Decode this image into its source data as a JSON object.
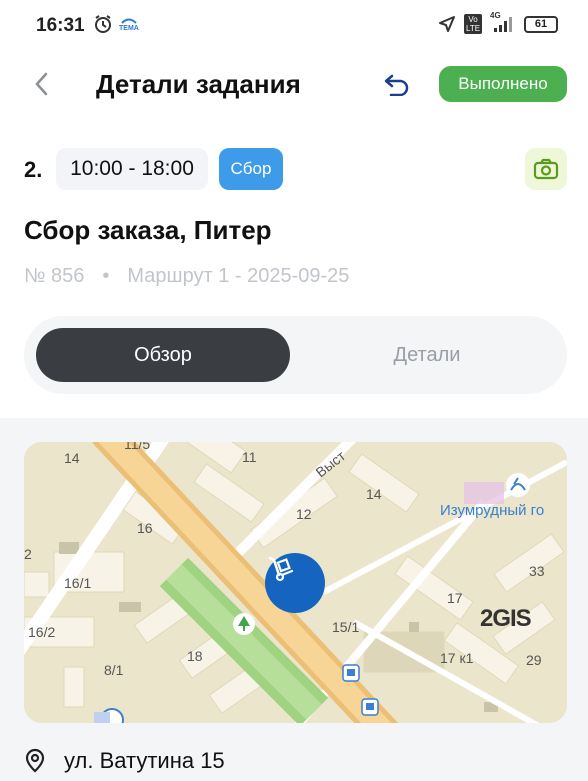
{
  "status_bar": {
    "time": "16:31",
    "battery": "61",
    "network_type": "4G",
    "volte_badge": "Vo LTE",
    "carrier_badge": "TEMA",
    "icons": [
      "alarm-icon",
      "location-arrow-icon",
      "signal-icon"
    ]
  },
  "header": {
    "title": "Детали задания",
    "done_button": "Выполнено",
    "icons": [
      "back-chevron-icon",
      "undo-icon"
    ]
  },
  "task": {
    "index": "2.",
    "time_range": "10:00 - 18:00",
    "type": "Сбор",
    "title": "Сбор заказа, Питер",
    "number": "№ 856",
    "separator": "•",
    "route": "Маршрут 1 - 2025-09-25",
    "camera_icon": "camera-icon"
  },
  "tabs": {
    "overview": "Обзор",
    "details": "Детали",
    "active": "overview"
  },
  "map": {
    "labels": [
      "14",
      "11",
      "14",
      "16",
      "12",
      "2",
      "16/1",
      "33",
      "17",
      "16/2",
      "15/1",
      "18",
      "8/1",
      "17 к1",
      "29",
      "11/5"
    ],
    "street": "Выст",
    "poi": "Изумрудный го",
    "logo": "2GIS",
    "pin_icon": "hand-truck-icon",
    "colors": {
      "road": "#f5c779",
      "park": "#a8d98a",
      "pin": "#1565c0",
      "background": "#e9e3c9"
    }
  },
  "address": {
    "text": "ул. Ватутина 15",
    "icon": "location-pin-icon"
  },
  "colors": {
    "done": "#4caf50",
    "type_chip": "#3d9be9",
    "segment_active": "#3a3d42"
  }
}
